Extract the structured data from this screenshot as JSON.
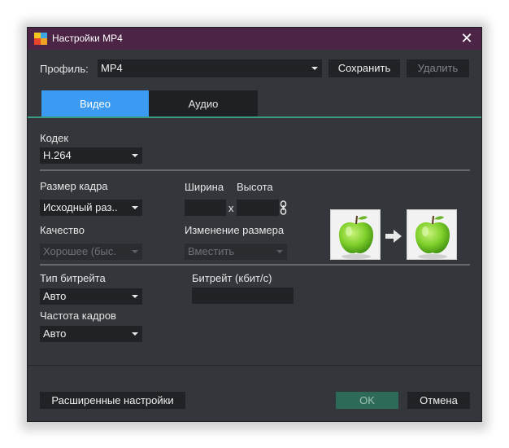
{
  "window": {
    "title": "Настройки MP4",
    "close_glyph": "✕"
  },
  "profile": {
    "label": "Профиль:",
    "value": "MP4",
    "save_label": "Сохранить",
    "delete_label": "Удалить"
  },
  "tabs": [
    {
      "label": "Видео",
      "active": true
    },
    {
      "label": "Аудио",
      "active": false
    }
  ],
  "codec": {
    "label": "Кодек",
    "value": "H.264"
  },
  "frame_size": {
    "label": "Размер кадра",
    "value": "Исходный раз.."
  },
  "dimensions": {
    "width_label": "Ширина",
    "height_label": "Высота",
    "times": "x",
    "width_value": "",
    "height_value": ""
  },
  "quality": {
    "label": "Качество",
    "value": "Хорошее (быс."
  },
  "resize": {
    "label": "Изменение размера",
    "value": "Вместить"
  },
  "bitrate_type": {
    "label": "Тип битрейта",
    "value": "Авто"
  },
  "bitrate": {
    "label": "Битрейт (кбит/с)",
    "value": ""
  },
  "framerate": {
    "label": "Частота кадров",
    "value": "Авто"
  },
  "footer": {
    "advanced_label": "Расширенные настройки",
    "ok_label": "OK",
    "cancel_label": "Отмена"
  },
  "icons": {
    "app": "app-logo-icon",
    "close": "close-icon",
    "dropdown": "chevron-down-icon",
    "link": "chain-link-icon",
    "preview_before": "apple-preview-icon",
    "preview_arrow": "arrow-right-icon",
    "preview_after": "apple-preview-icon"
  },
  "colors": {
    "titlebar": "#4c2446",
    "window_bg": "#33363b",
    "active_tab": "#3b9bf2",
    "tab_underline": "#3c9a86",
    "ok_button": "#2d6b58",
    "field_bg": "#202226"
  }
}
